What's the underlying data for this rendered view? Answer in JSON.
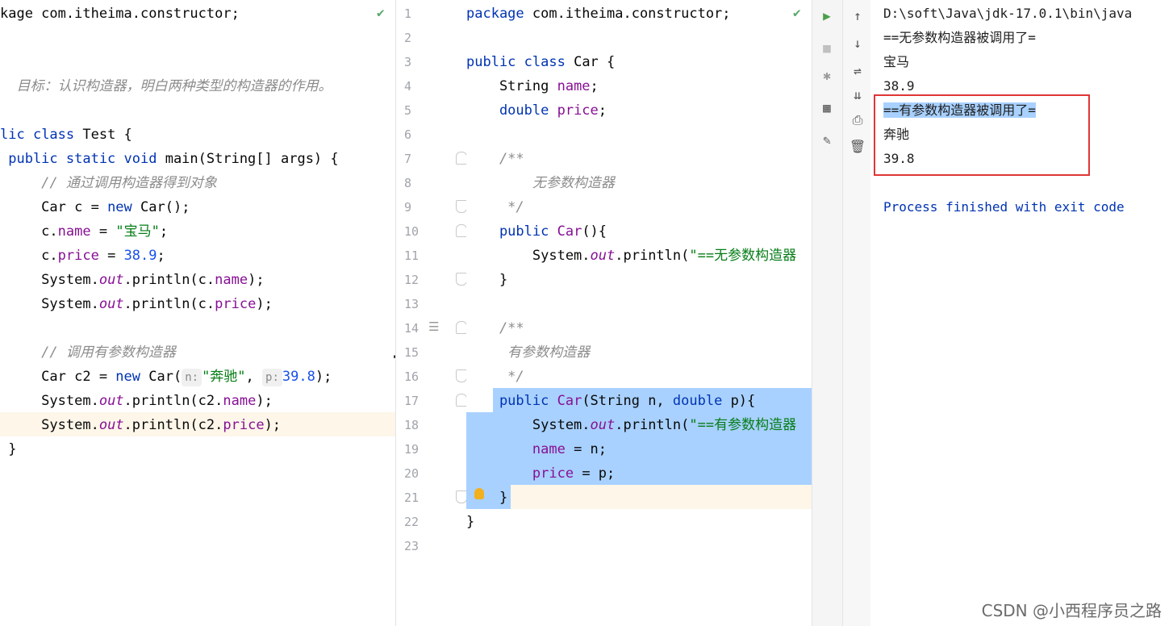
{
  "left_editor": {
    "lines": [
      {
        "parts": [
          {
            "t": "kage com.itheima.constructor;",
            "c": ""
          }
        ]
      },
      {
        "parts": []
      },
      {
        "parts": []
      },
      {
        "parts": [
          {
            "t": "  目标：认识构造器，明白两种类型的构造器的作用。",
            "c": "cmt"
          }
        ]
      },
      {
        "parts": []
      },
      {
        "parts": [
          {
            "t": "lic ",
            "c": "kw"
          },
          {
            "t": "class ",
            "c": "kw"
          },
          {
            "t": "Test {",
            "c": ""
          }
        ]
      },
      {
        "parts": [
          {
            "t": " public static void ",
            "c": "kw"
          },
          {
            "t": "main(String[] args) {",
            "c": ""
          }
        ]
      },
      {
        "parts": [
          {
            "t": "     // 通过调用构造器得到对象",
            "c": "cmt"
          }
        ]
      },
      {
        "parts": [
          {
            "t": "     Car c = ",
            "c": ""
          },
          {
            "t": "new ",
            "c": "kw"
          },
          {
            "t": "Car();",
            "c": ""
          }
        ]
      },
      {
        "parts": [
          {
            "t": "     c.",
            "c": ""
          },
          {
            "t": "name",
            "c": "fld"
          },
          {
            "t": " = ",
            "c": ""
          },
          {
            "t": "\"宝马\"",
            "c": "str"
          },
          {
            "t": ";",
            "c": ""
          }
        ]
      },
      {
        "parts": [
          {
            "t": "     c.",
            "c": ""
          },
          {
            "t": "price",
            "c": "fld"
          },
          {
            "t": " = ",
            "c": ""
          },
          {
            "t": "38.9",
            "c": "num"
          },
          {
            "t": ";",
            "c": ""
          }
        ]
      },
      {
        "parts": [
          {
            "t": "     System.",
            "c": ""
          },
          {
            "t": "out",
            "c": "ital"
          },
          {
            "t": ".println(c.",
            "c": ""
          },
          {
            "t": "name",
            "c": "fld"
          },
          {
            "t": ");",
            "c": ""
          }
        ]
      },
      {
        "parts": [
          {
            "t": "     System.",
            "c": ""
          },
          {
            "t": "out",
            "c": "ital"
          },
          {
            "t": ".println(c.",
            "c": ""
          },
          {
            "t": "price",
            "c": "fld"
          },
          {
            "t": ");",
            "c": ""
          }
        ]
      },
      {
        "parts": []
      },
      {
        "parts": [
          {
            "t": "     // 调用有参数构造器",
            "c": "cmt"
          }
        ]
      },
      {
        "parts": [
          {
            "t": "     Car c2 = ",
            "c": ""
          },
          {
            "t": "new ",
            "c": "kw"
          },
          {
            "t": "Car(",
            "c": ""
          },
          {
            "t": "n:",
            "c": "hint"
          },
          {
            "t": "\"奔驰\"",
            "c": "str"
          },
          {
            "t": ", ",
            "c": ""
          },
          {
            "t": "p:",
            "c": "hint"
          },
          {
            "t": "39.8",
            "c": "num"
          },
          {
            "t": ");",
            "c": ""
          }
        ]
      },
      {
        "parts": [
          {
            "t": "     System.",
            "c": ""
          },
          {
            "t": "out",
            "c": "ital"
          },
          {
            "t": ".println(c2.",
            "c": ""
          },
          {
            "t": "name",
            "c": "fld"
          },
          {
            "t": ");",
            "c": ""
          }
        ]
      },
      {
        "parts": [
          {
            "t": "     System.",
            "c": ""
          },
          {
            "t": "out",
            "c": "ital"
          },
          {
            "t": ".println(c2.",
            "c": ""
          },
          {
            "t": "price",
            "c": "fld"
          },
          {
            "t": ");",
            "c": ""
          }
        ]
      },
      {
        "parts": [
          {
            "t": " }",
            "c": ""
          }
        ]
      }
    ]
  },
  "right_editor": {
    "line_numbers": [
      "1",
      "2",
      "3",
      "4",
      "5",
      "6",
      "7",
      "8",
      "9",
      "10",
      "11",
      "12",
      "13",
      "14",
      "15",
      "16",
      "17",
      "18",
      "19",
      "20",
      "21",
      "22",
      "23"
    ],
    "lines": [
      {
        "parts": [
          {
            "t": "package ",
            "c": "kw"
          },
          {
            "t": "com.itheima.constructor;",
            "c": ""
          }
        ]
      },
      {
        "parts": []
      },
      {
        "parts": [
          {
            "t": "public ",
            "c": "kw"
          },
          {
            "t": "class ",
            "c": "kw"
          },
          {
            "t": "Car {",
            "c": ""
          }
        ]
      },
      {
        "parts": [
          {
            "t": "    String ",
            "c": ""
          },
          {
            "t": "name",
            "c": "fld"
          },
          {
            "t": ";",
            "c": ""
          }
        ]
      },
      {
        "parts": [
          {
            "t": "    double ",
            "c": "kw"
          },
          {
            "t": "price",
            "c": "fld"
          },
          {
            "t": ";",
            "c": ""
          }
        ]
      },
      {
        "parts": []
      },
      {
        "parts": [
          {
            "t": "    /**",
            "c": "cmt"
          }
        ]
      },
      {
        "parts": [
          {
            "t": "        无参数构造器",
            "c": "cmt"
          }
        ]
      },
      {
        "parts": [
          {
            "t": "     */",
            "c": "cmt"
          }
        ]
      },
      {
        "parts": [
          {
            "t": "    public ",
            "c": "kw"
          },
          {
            "t": "Car",
            "c": "fld"
          },
          {
            "t": "(){",
            "c": ""
          }
        ]
      },
      {
        "parts": [
          {
            "t": "        System.",
            "c": ""
          },
          {
            "t": "out",
            "c": "ital"
          },
          {
            "t": ".println(",
            "c": ""
          },
          {
            "t": "\"==无参数构造器",
            "c": "str"
          }
        ]
      },
      {
        "parts": [
          {
            "t": "    }",
            "c": ""
          }
        ]
      },
      {
        "parts": []
      },
      {
        "parts": [
          {
            "t": "    /**",
            "c": "cmt"
          }
        ]
      },
      {
        "parts": [
          {
            "t": "     有参数构造器",
            "c": "cmt"
          }
        ]
      },
      {
        "parts": [
          {
            "t": "     */",
            "c": "cmt"
          }
        ]
      },
      {
        "parts": [
          {
            "t": "    public ",
            "c": "kw"
          },
          {
            "t": "Car",
            "c": "fld"
          },
          {
            "t": "(String n, ",
            "c": ""
          },
          {
            "t": "double ",
            "c": "kw"
          },
          {
            "t": "p){",
            "c": ""
          }
        ]
      },
      {
        "parts": [
          {
            "t": "        System.",
            "c": ""
          },
          {
            "t": "out",
            "c": "ital"
          },
          {
            "t": ".println(",
            "c": ""
          },
          {
            "t": "\"==有参数构造器",
            "c": "str"
          }
        ]
      },
      {
        "parts": [
          {
            "t": "        ",
            "c": ""
          },
          {
            "t": "name",
            "c": "fld"
          },
          {
            "t": " = n;",
            "c": ""
          }
        ]
      },
      {
        "parts": [
          {
            "t": "        ",
            "c": ""
          },
          {
            "t": "price",
            "c": "fld"
          },
          {
            "t": " = p;",
            "c": ""
          }
        ]
      },
      {
        "parts": [
          {
            "t": "    }",
            "c": ""
          }
        ]
      },
      {
        "parts": [
          {
            "t": "}",
            "c": ""
          }
        ]
      },
      {
        "parts": []
      }
    ]
  },
  "console": {
    "lines": [
      {
        "t": "D:\\soft\\Java\\jdk-17.0.1\\bin\\java",
        "c": "c-path"
      },
      {
        "t": "==无参数构造器被调用了=",
        "c": "c-out"
      },
      {
        "t": "宝马",
        "c": "c-out"
      },
      {
        "t": "38.9",
        "c": "c-out"
      },
      {
        "t": "==有参数构造器被调用了=",
        "c": "c-out c-sel"
      },
      {
        "t": "奔驰",
        "c": "c-out"
      },
      {
        "t": "39.8",
        "c": "c-out"
      },
      {
        "t": "",
        "c": ""
      },
      {
        "t": "Process finished with exit code",
        "c": "c-proc"
      }
    ]
  },
  "run_toolbar_icons": [
    "run-icon",
    "stop-icon",
    "debug-icon",
    "layout-icon",
    "pin-icon"
  ],
  "console_toolbar_icons": [
    "arrow-up-icon",
    "arrow-down-icon",
    "soft-wrap-icon",
    "scroll-to-end-icon",
    "print-icon",
    "trash-icon"
  ],
  "icon_glyphs": {
    "run-icon": "▶",
    "stop-icon": "■",
    "debug-icon": "✱",
    "layout-icon": "▦",
    "pin-icon": "✎",
    "arrow-up-icon": "↑",
    "arrow-down-icon": "↓",
    "soft-wrap-icon": "⇌",
    "scroll-to-end-icon": "⇊",
    "print-icon": "⎙",
    "trash-icon": "🗑"
  },
  "watermark": "CSDN @小西程序员之路",
  "colors": {
    "selection": "#a8d1ff",
    "highlight_box": "#e03636",
    "keyword": "#0033b3",
    "string": "#067d17"
  }
}
